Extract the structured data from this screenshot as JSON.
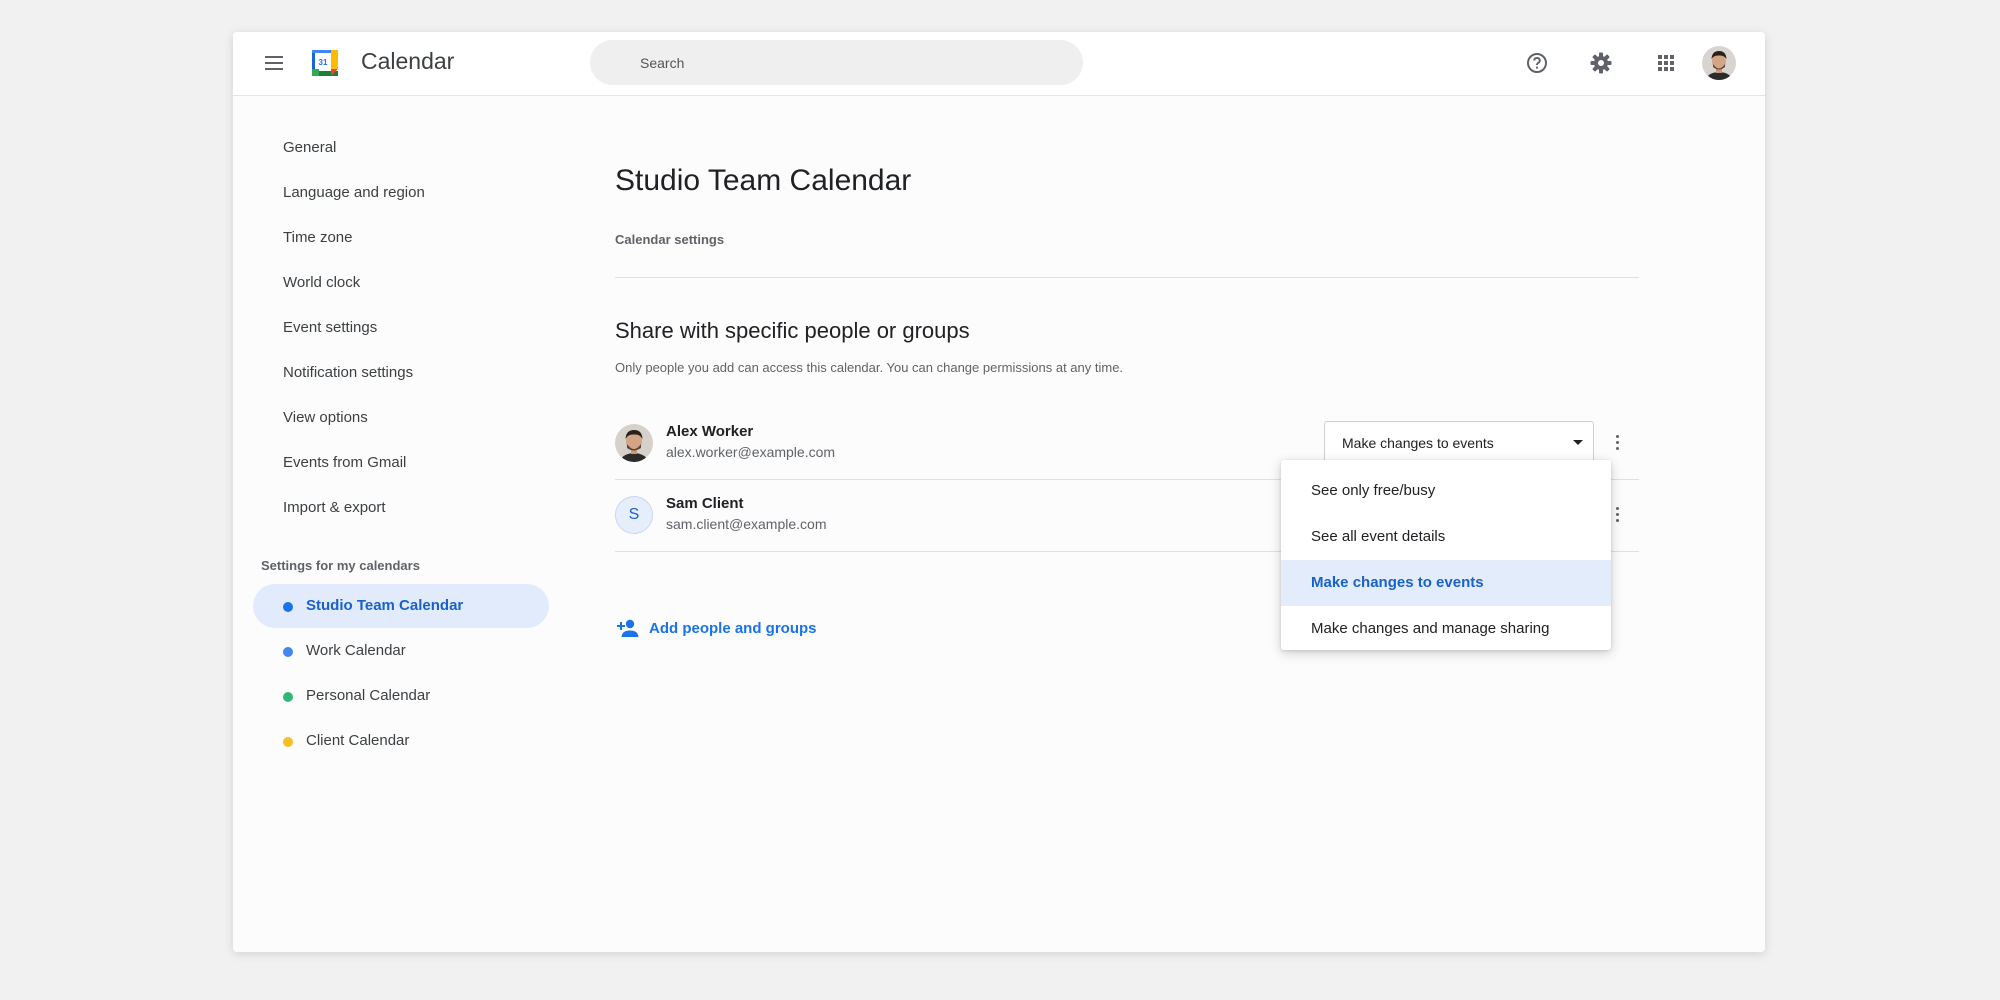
{
  "header": {
    "app_title": "Calendar",
    "search_placeholder": "Search",
    "icons": [
      "menu-icon",
      "calendar-logo-icon",
      "help-icon",
      "settings-gear-icon",
      "apps-grid-icon",
      "account-avatar"
    ],
    "logo_day": "31"
  },
  "sidebar": {
    "general_items": [
      "General",
      "Language and region",
      "Time zone",
      "World clock",
      "Event settings",
      "Notification settings",
      "View options",
      "Events from Gmail",
      "Import & export"
    ],
    "section_label": "Settings for my calendars",
    "calendars": [
      {
        "label": "Studio Team Calendar",
        "color": "#1a73e8",
        "active": true
      },
      {
        "label": "Work Calendar",
        "color": "#4285f4",
        "active": false
      },
      {
        "label": "Personal Calendar",
        "color": "#33b679",
        "active": false
      },
      {
        "label": "Client Calendar",
        "color": "#f6bf26",
        "active": false
      }
    ]
  },
  "main": {
    "page_title": "Studio Team Calendar",
    "breadcrumb": "Calendar settings",
    "share_title": "Share with specific people or groups",
    "share_description": "Only people you add can access this calendar. You can change permissions at any time.",
    "people": [
      {
        "name": "Alex Worker",
        "email": "alex.worker@example.com",
        "permission": "Make changes to events",
        "avatar": "photo"
      },
      {
        "name": "Sam Client",
        "email": "sam.client@example.com",
        "initial": "S",
        "avatar": "initial"
      }
    ],
    "add_people_label": "Add people and groups"
  },
  "permission_dropdown": {
    "options": [
      "See only free/busy",
      "See all event details",
      "Make changes to events",
      "Make changes and manage sharing"
    ],
    "selected": "Make changes to events"
  },
  "colors": {
    "accent": "#1a73e8",
    "active_nav_bg": "#e2ebfb",
    "selected_option_bg": "#e3ecfb"
  }
}
